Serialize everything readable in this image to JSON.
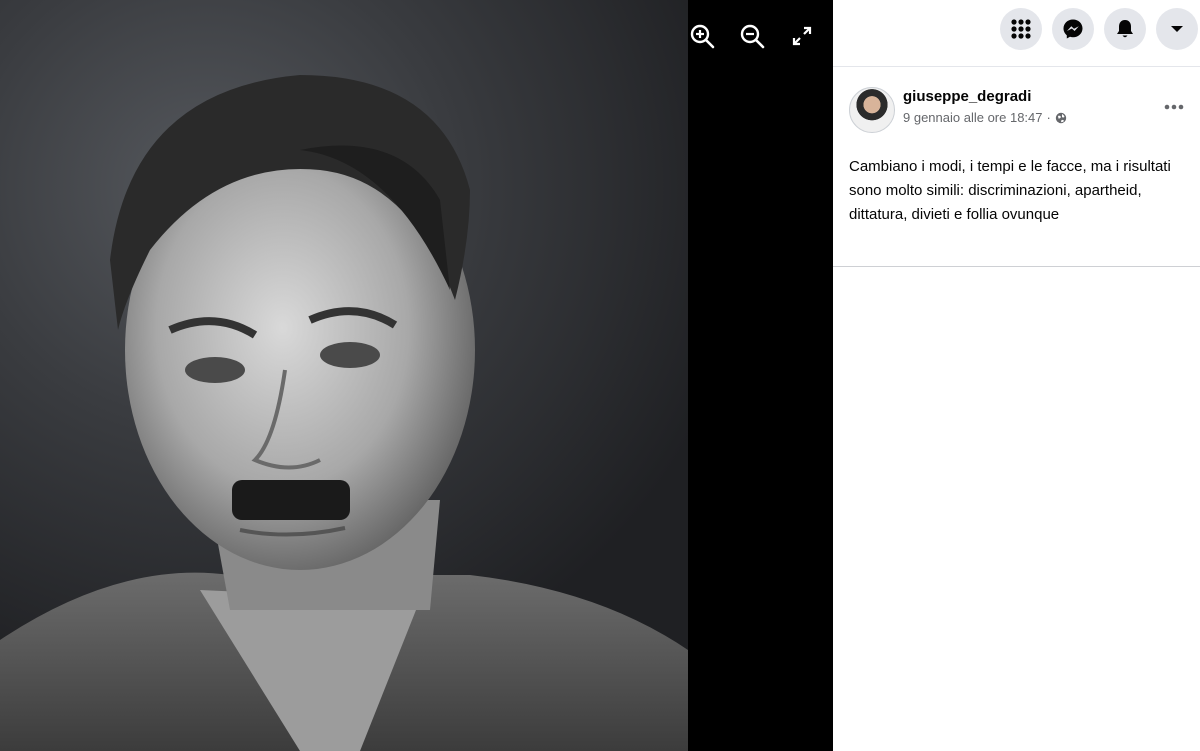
{
  "viewer": {
    "photo_alt": "",
    "controls": [
      "zoom-in-icon",
      "zoom-out-icon",
      "fullscreen-icon"
    ]
  },
  "topbar": {
    "icons": [
      "menu-grid-icon",
      "messenger-icon",
      "bell-icon",
      "caret-down-icon"
    ]
  },
  "post": {
    "author": "giuseppe_degradi",
    "date": "9 gennaio alle ore 18:47",
    "separator": "·",
    "privacy_icon": "globe-icon",
    "text": "Cambiano i modi, i tempi e le facce, ma i risultati sono molto simili: discriminazioni, apartheid, dittatura, divieti e follia ovunque"
  },
  "colors": {
    "sidebar_bg": "#ffffff",
    "button_bg": "#e4e6eb",
    "secondary_text": "#65676b",
    "viewer_bg": "#000000"
  }
}
